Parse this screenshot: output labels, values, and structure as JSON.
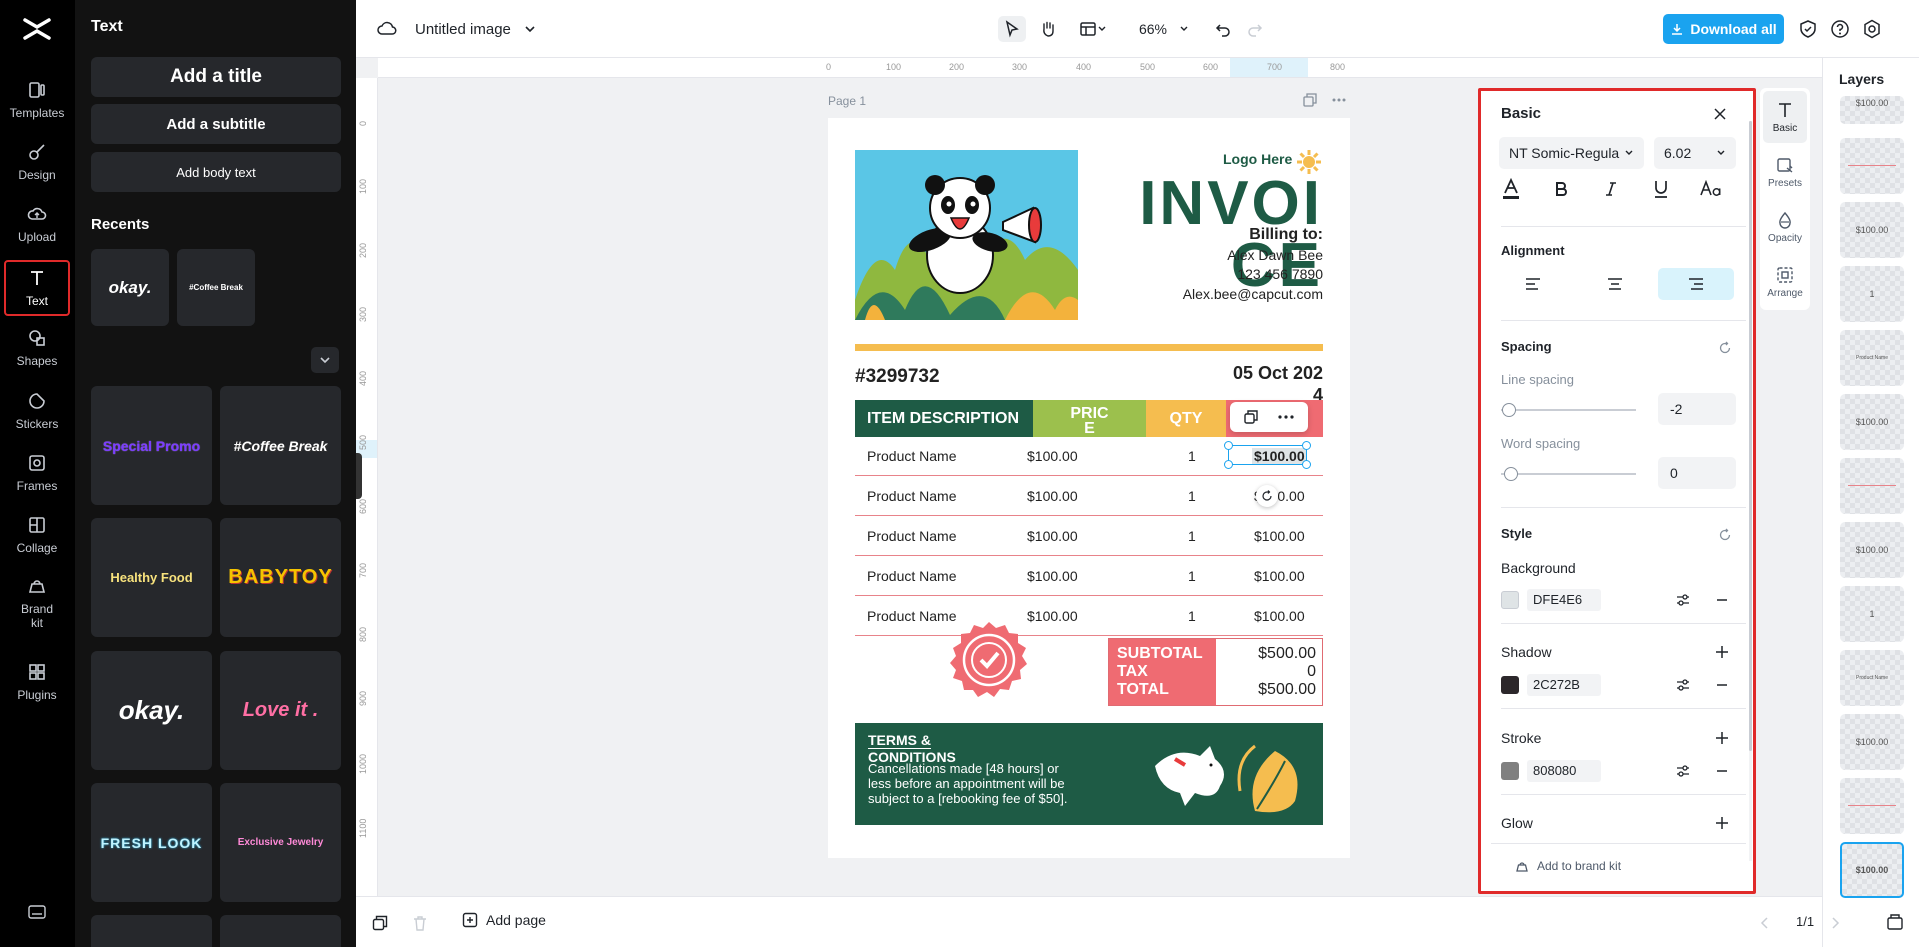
{
  "rail": {
    "items": [
      {
        "label": "Templates"
      },
      {
        "label": "Design"
      },
      {
        "label": "Upload"
      },
      {
        "label": "Text"
      },
      {
        "label": "Shapes"
      },
      {
        "label": "Stickers"
      },
      {
        "label": "Frames"
      },
      {
        "label": "Collage"
      },
      {
        "label": "Brand kit"
      },
      {
        "label": "Plugins"
      }
    ]
  },
  "text_panel": {
    "title": "Text",
    "add_title": "Add a title",
    "add_subtitle": "Add a subtitle",
    "add_body": "Add body text",
    "recents_title": "Recents",
    "recents": [
      "okay.",
      "#Coffee Break"
    ],
    "templates": [
      "Special Promo",
      "#Coffee Break",
      "Healthy Food",
      "BABYTOY",
      "okay.",
      "Love it .",
      "FRESH LOOK",
      "Exclusive Jewelry"
    ]
  },
  "topbar": {
    "doc_title": "Untitled image",
    "zoom": "66%",
    "download_label": "Download all"
  },
  "ruler": {
    "h_ticks": [
      "0",
      "100",
      "200",
      "300",
      "400",
      "500",
      "600",
      "700",
      "800"
    ],
    "v_ticks": [
      "0",
      "100",
      "200",
      "300",
      "400",
      "500",
      "600",
      "700",
      "800",
      "900",
      "1000",
      "1100"
    ]
  },
  "canvas": {
    "page_label": "Page 1"
  },
  "invoice": {
    "logo_text": "Logo Here",
    "title_line1": "INVOI",
    "title_line2": "CE",
    "billing_to": "Billing to:",
    "bill_name": "Alex Dawn Bee",
    "bill_phone": "123 456 7890",
    "bill_email": "Alex.bee@capcut.com",
    "number": "#3299732",
    "date_line1": "05 Oct 202",
    "date_line2": "4",
    "headers": {
      "desc": "ITEM DESCRIPTION",
      "price_line1": "PRIC",
      "price_line2": "E",
      "qty": "QTY"
    },
    "rows": [
      {
        "name": "Product Name",
        "price": "$100.00",
        "qty": "1",
        "total": "$100.00"
      },
      {
        "name": "Product Name",
        "price": "$100.00",
        "qty": "1",
        "total": "$100.00"
      },
      {
        "name": "Product Name",
        "price": "$100.00",
        "qty": "1",
        "total": "$100.00"
      },
      {
        "name": "Product Name",
        "price": "$100.00",
        "qty": "1",
        "total": "$100.00"
      },
      {
        "name": "Product Name",
        "price": "$100.00",
        "qty": "1",
        "total": "$100.00"
      }
    ],
    "totals": {
      "subtotal_label": "SUBTOTAL",
      "tax_label": "TAX",
      "total_label": "TOTAL",
      "subtotal": "$500.00",
      "tax": "0",
      "total": "$500.00"
    },
    "terms_title_line1": "TERMS &",
    "terms_title_line2": "CONDITIONS",
    "terms_line1": "Cancellations made [48 hours] or",
    "terms_line2": "less before an appointment will be",
    "terms_line3": "subject to a [rebooking fee of $50]."
  },
  "props": {
    "title": "Basic",
    "font": "NT Somic-Regula",
    "font_size": "6.02",
    "alignment_title": "Alignment",
    "spacing_title": "Spacing",
    "line_spacing_label": "Line spacing",
    "line_spacing": "-2",
    "word_spacing_label": "Word spacing",
    "word_spacing": "0",
    "style_title": "Style",
    "background_label": "Background",
    "background_color": "DFE4E6",
    "shadow_label": "Shadow",
    "shadow_color": "2C272B",
    "stroke_label": "Stroke",
    "stroke_color": "808080",
    "glow_label": "Glow",
    "brand_kit": "Add to brand kit",
    "colors": {
      "background": "#dfe4e6",
      "shadow": "#2c272b",
      "stroke": "#808080"
    }
  },
  "side_tabs": [
    {
      "label": "Basic"
    },
    {
      "label": "Presets"
    },
    {
      "label": "Opacity"
    },
    {
      "label": "Arrange"
    }
  ],
  "layers": {
    "title": "Layers",
    "items": [
      "$100.00",
      "",
      "$100.00",
      "1",
      "Product Name",
      "$100.00",
      "",
      "$100.00",
      "1",
      "Product Name",
      "$100.00",
      "",
      "$100.00"
    ]
  },
  "bottombar": {
    "add_page": "Add page",
    "pages": "1/1"
  }
}
